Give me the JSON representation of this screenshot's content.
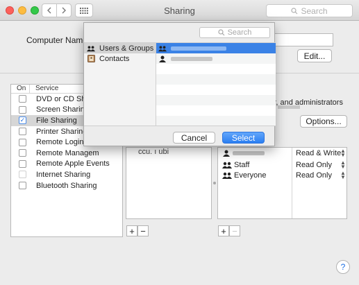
{
  "window": {
    "title": "Sharing",
    "search_placeholder": "Search"
  },
  "computer_name": {
    "label": "Computer Name:",
    "edit_label": "Edit..."
  },
  "services": {
    "col_on": "On",
    "col_service": "Service",
    "items": [
      {
        "label": "DVD or CD Sha",
        "checked": false
      },
      {
        "label": "Screen Sharing",
        "checked": false
      },
      {
        "label": "File Sharing",
        "checked": true
      },
      {
        "label": "Printer Sharing",
        "checked": false
      },
      {
        "label": "Remote Login",
        "checked": false
      },
      {
        "label": "Remote Managem",
        "checked": false
      },
      {
        "label": "Remote Apple Events",
        "checked": false
      },
      {
        "label": "Internet Sharing",
        "checked": false
      },
      {
        "label": "Bluetooth Sharing",
        "checked": false
      }
    ]
  },
  "detail": {
    "note": "uter, and administrators",
    "options_label": "Options...",
    "folder_fragment": "ccu. ı ubi"
  },
  "users": [
    {
      "name": "",
      "perm": "Read & Write"
    },
    {
      "name": "Staff",
      "perm": "Read Only"
    },
    {
      "name": "Everyone",
      "perm": "Read Only"
    }
  ],
  "sheet": {
    "search_placeholder": "Search",
    "sources": [
      "Users & Groups",
      "Contacts"
    ],
    "cancel_label": "Cancel",
    "select_label": "Select"
  },
  "help_label": "?"
}
